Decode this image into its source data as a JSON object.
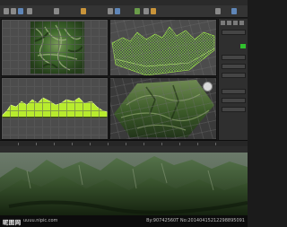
{
  "app": {
    "accent": "#31c12e",
    "viewport_bg": "#4c4c4c",
    "toolbar_icons": [
      "select-icon",
      "move-icon",
      "rotate-icon",
      "scale-icon",
      "snap-icon",
      "render-icon",
      "material-icon",
      "curve-icon"
    ]
  },
  "viewports": [
    {
      "id": "top",
      "content": "terrain-heightmap-top-view"
    },
    {
      "id": "front",
      "content": "terrain-wireframe-mesh"
    },
    {
      "id": "left",
      "content": "terrain-wireframe-side"
    },
    {
      "id": "perspective",
      "content": "terrain-textured-perspective"
    }
  ],
  "render": {
    "content": "rendered-mountain-landscape"
  },
  "watermark": {
    "logo": "昵图网",
    "site": "uuuu.nipic.com",
    "id": "By:90742560T No:20140415212298895091"
  }
}
